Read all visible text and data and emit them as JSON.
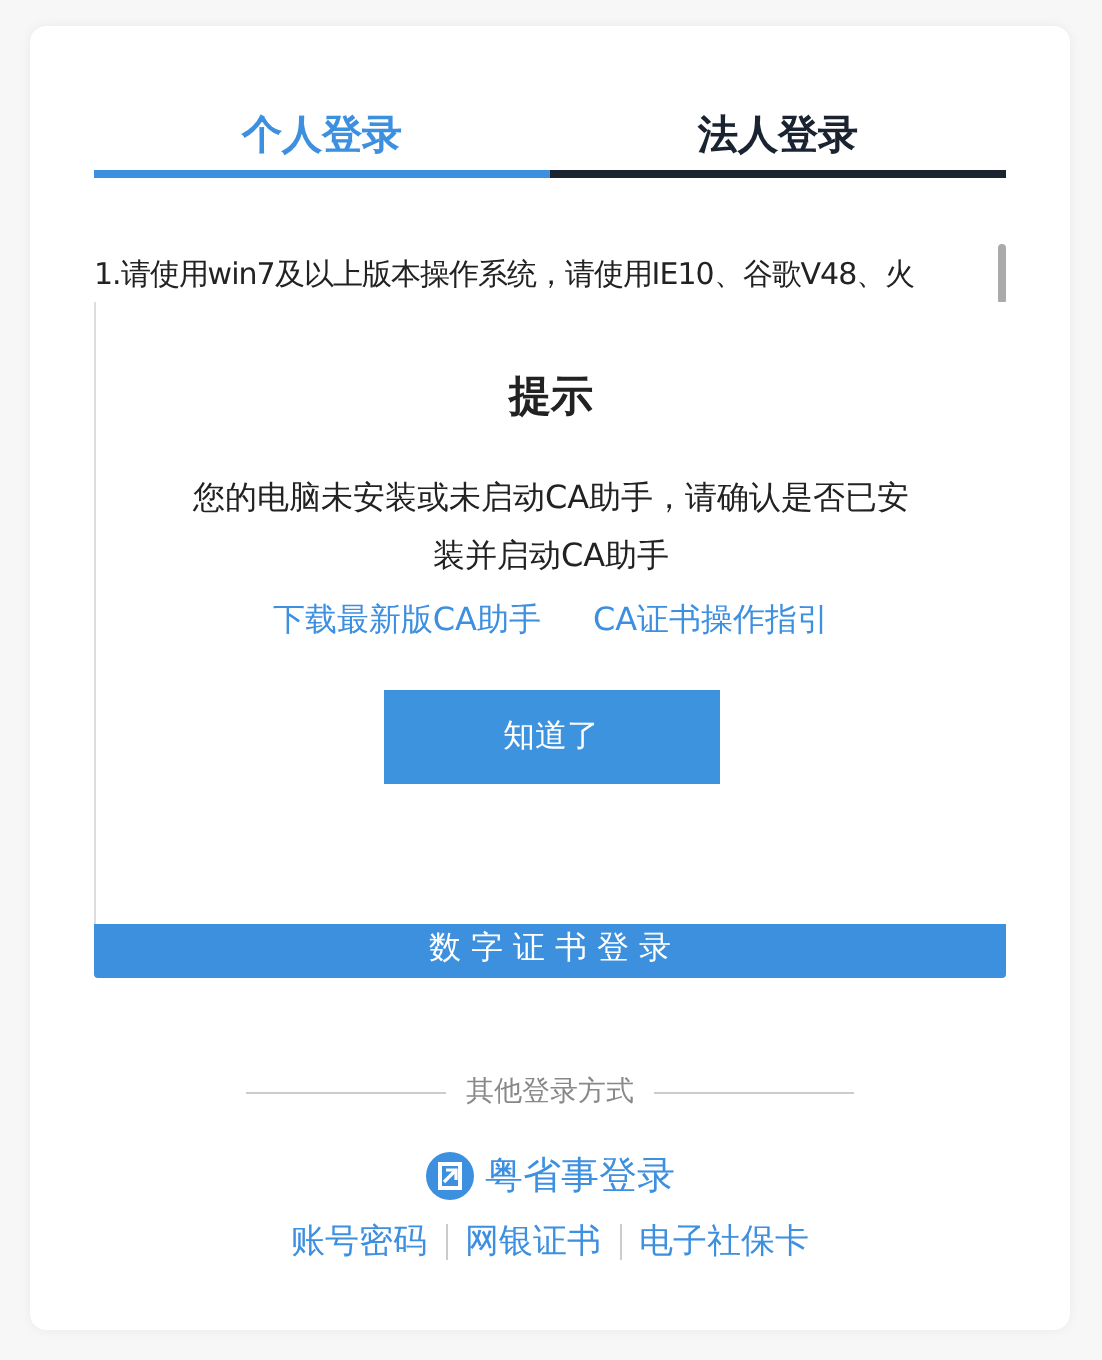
{
  "tabs": [
    {
      "label": "个人登录",
      "selected": true
    },
    {
      "label": "法人登录",
      "selected": false
    }
  ],
  "notice_text": "1.请使用win7及以上版本操作系统，请使用IE10、谷歌V48、火",
  "login_button": "数 字 证 书 登 录",
  "dialog": {
    "title": "提示",
    "message": "您的电脑未安装或未启动CA助手，请确认是否已安装并启动CA助手",
    "links": [
      "下载最新版CA助手",
      "CA证书操作指引"
    ],
    "button": "知道了"
  },
  "other_methods": {
    "label": "其他登录方式",
    "primary_link": "粤省事登录",
    "links": [
      "账号密码",
      "网银证书",
      "电子社保卡"
    ]
  }
}
